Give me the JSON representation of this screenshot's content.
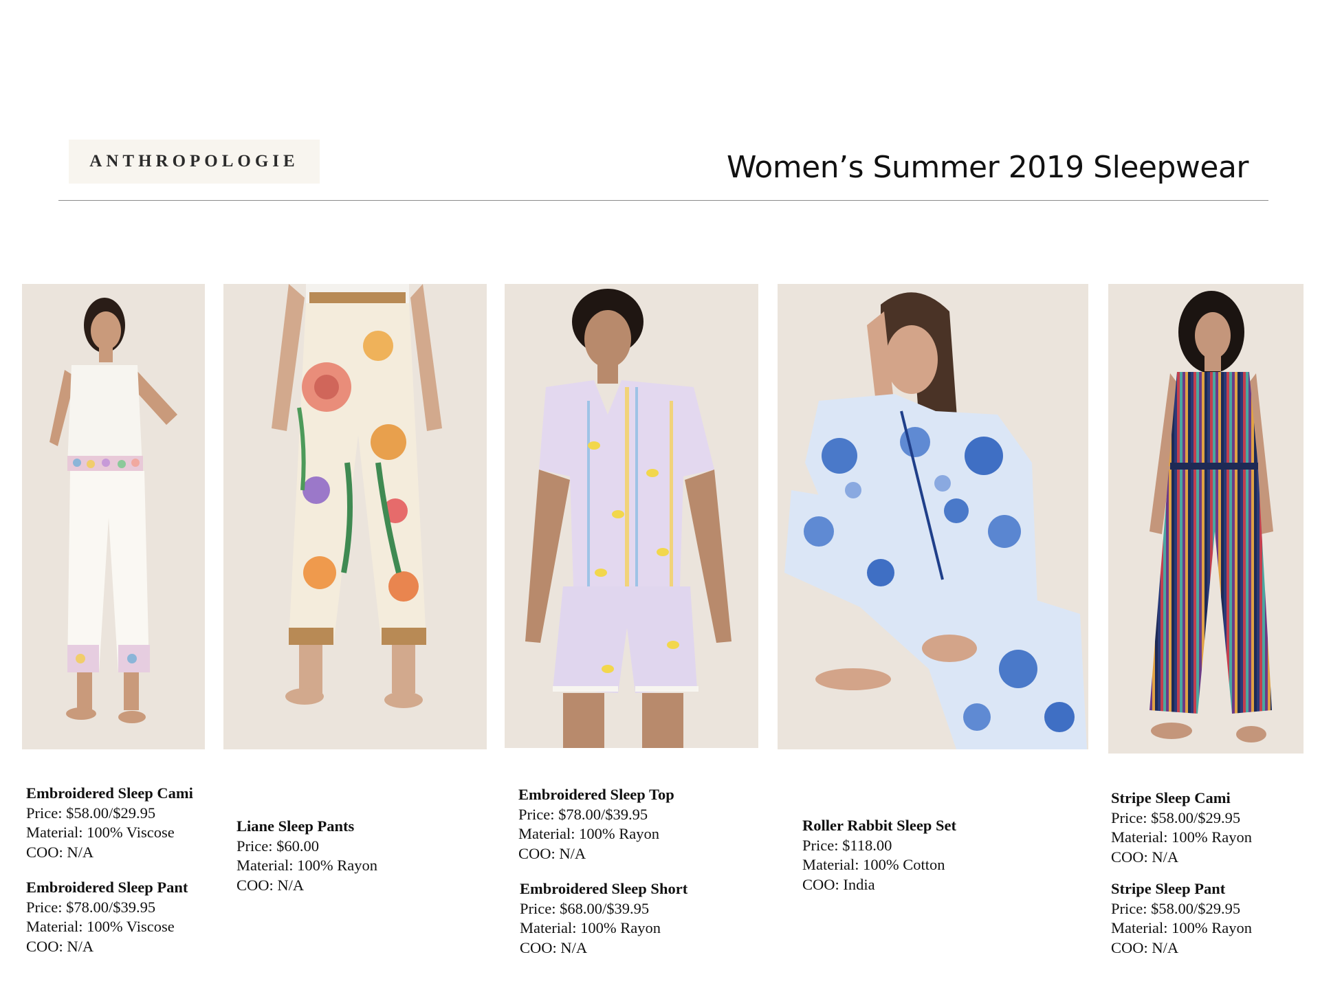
{
  "header": {
    "brand_logo_text": "ANTHROPOLOGIE",
    "title": "Women’s Summer 2019 Sleepwear"
  },
  "products": [
    {
      "name": "Embroidered Sleep Cami",
      "price": "Price: $58.00/$29.95",
      "material": "Material: 100% Viscose",
      "coo": "COO: N/A"
    },
    {
      "name": "Embroidered Sleep Pant",
      "price": "Price: $78.00/$39.95",
      "material": "Material: 100% Viscose",
      "coo": "COO: N/A"
    },
    {
      "name": "Liane Sleep Pants",
      "price": "Price: $60.00",
      "material": "Material: 100% Rayon",
      "coo": "COO: N/A"
    },
    {
      "name": "Embroidered Sleep Top",
      "price": "Price: $78.00/$39.95",
      "material": "Material: 100% Rayon",
      "coo": "COO: N/A"
    },
    {
      "name": "Embroidered Sleep Short",
      "price": "Price: $68.00/$39.95",
      "material": "Material: 100% Rayon",
      "coo": "COO: N/A"
    },
    {
      "name": "Roller Rabbit Sleep Set",
      "price": "Price: $118.00",
      "material": "Material: 100% Cotton",
      "coo": "COO: India"
    },
    {
      "name": "Stripe Sleep Cami",
      "price": "Price: $58.00/$29.95",
      "material": "Material: 100% Rayon",
      "coo": "COO: N/A"
    },
    {
      "name": "Stripe Sleep Pant",
      "price": "Price: $58.00/$29.95",
      "material": "Material: 100% Rayon",
      "coo": "COO: N/A"
    }
  ],
  "colors": {
    "photo_background": "#ebe4dc",
    "logo_background": "#f8f5ef",
    "divider": "#8a8a8a"
  }
}
